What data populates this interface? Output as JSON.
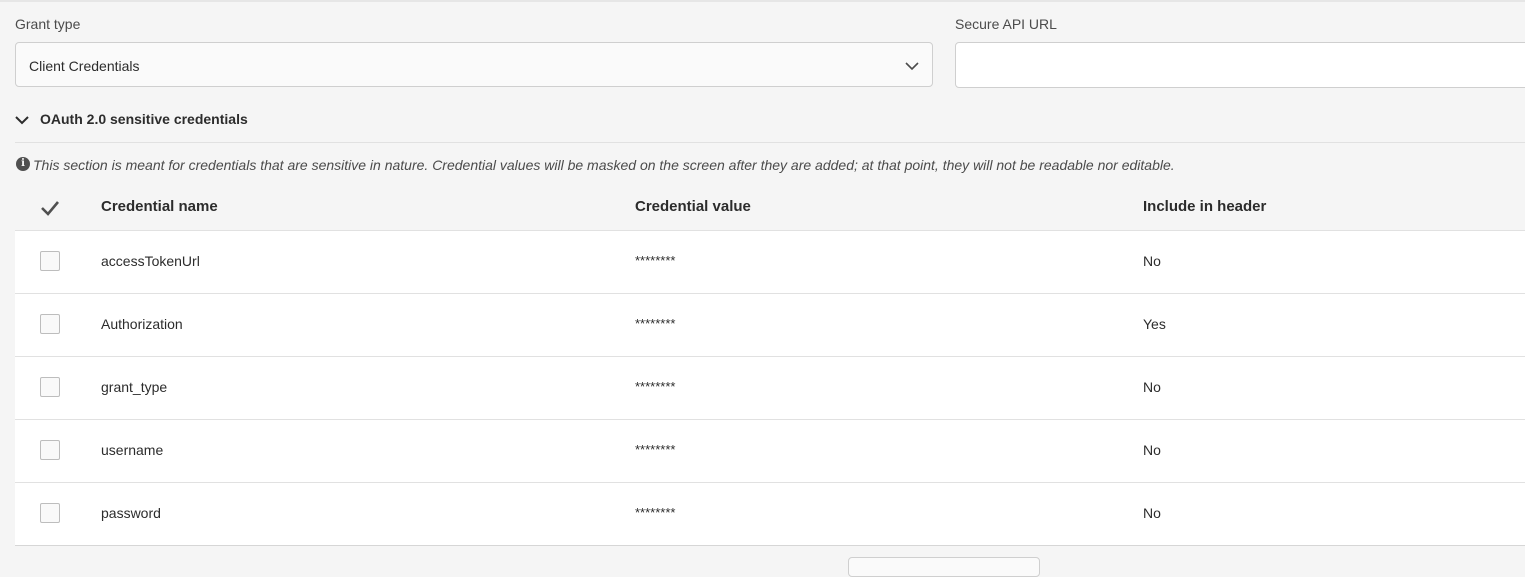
{
  "grant_type": {
    "label": "Grant type",
    "value": "Client Credentials",
    "chevron_icon": "chevron-down-icon"
  },
  "secure_api_url": {
    "label": "Secure API URL",
    "value": ""
  },
  "section": {
    "title": "OAuth 2.0 sensitive credentials",
    "expanded": true,
    "info_icon": "info-icon",
    "info_text": "This section is meant for credentials that are sensitive in nature. Credential values will be masked on the screen after they are added; at that point, they will not be readable nor editable."
  },
  "table": {
    "select_all_icon": "checkmark-icon",
    "columns": [
      "Credential name",
      "Credential value",
      "Include in header"
    ],
    "rows": [
      {
        "name": "accessTokenUrl",
        "value": "********",
        "include_in_header": "No",
        "checked": false
      },
      {
        "name": "Authorization",
        "value": "********",
        "include_in_header": "Yes",
        "checked": false
      },
      {
        "name": "grant_type",
        "value": "********",
        "include_in_header": "No",
        "checked": false
      },
      {
        "name": "username",
        "value": "********",
        "include_in_header": "No",
        "checked": false
      },
      {
        "name": "password",
        "value": "********",
        "include_in_header": "No",
        "checked": false
      }
    ]
  }
}
